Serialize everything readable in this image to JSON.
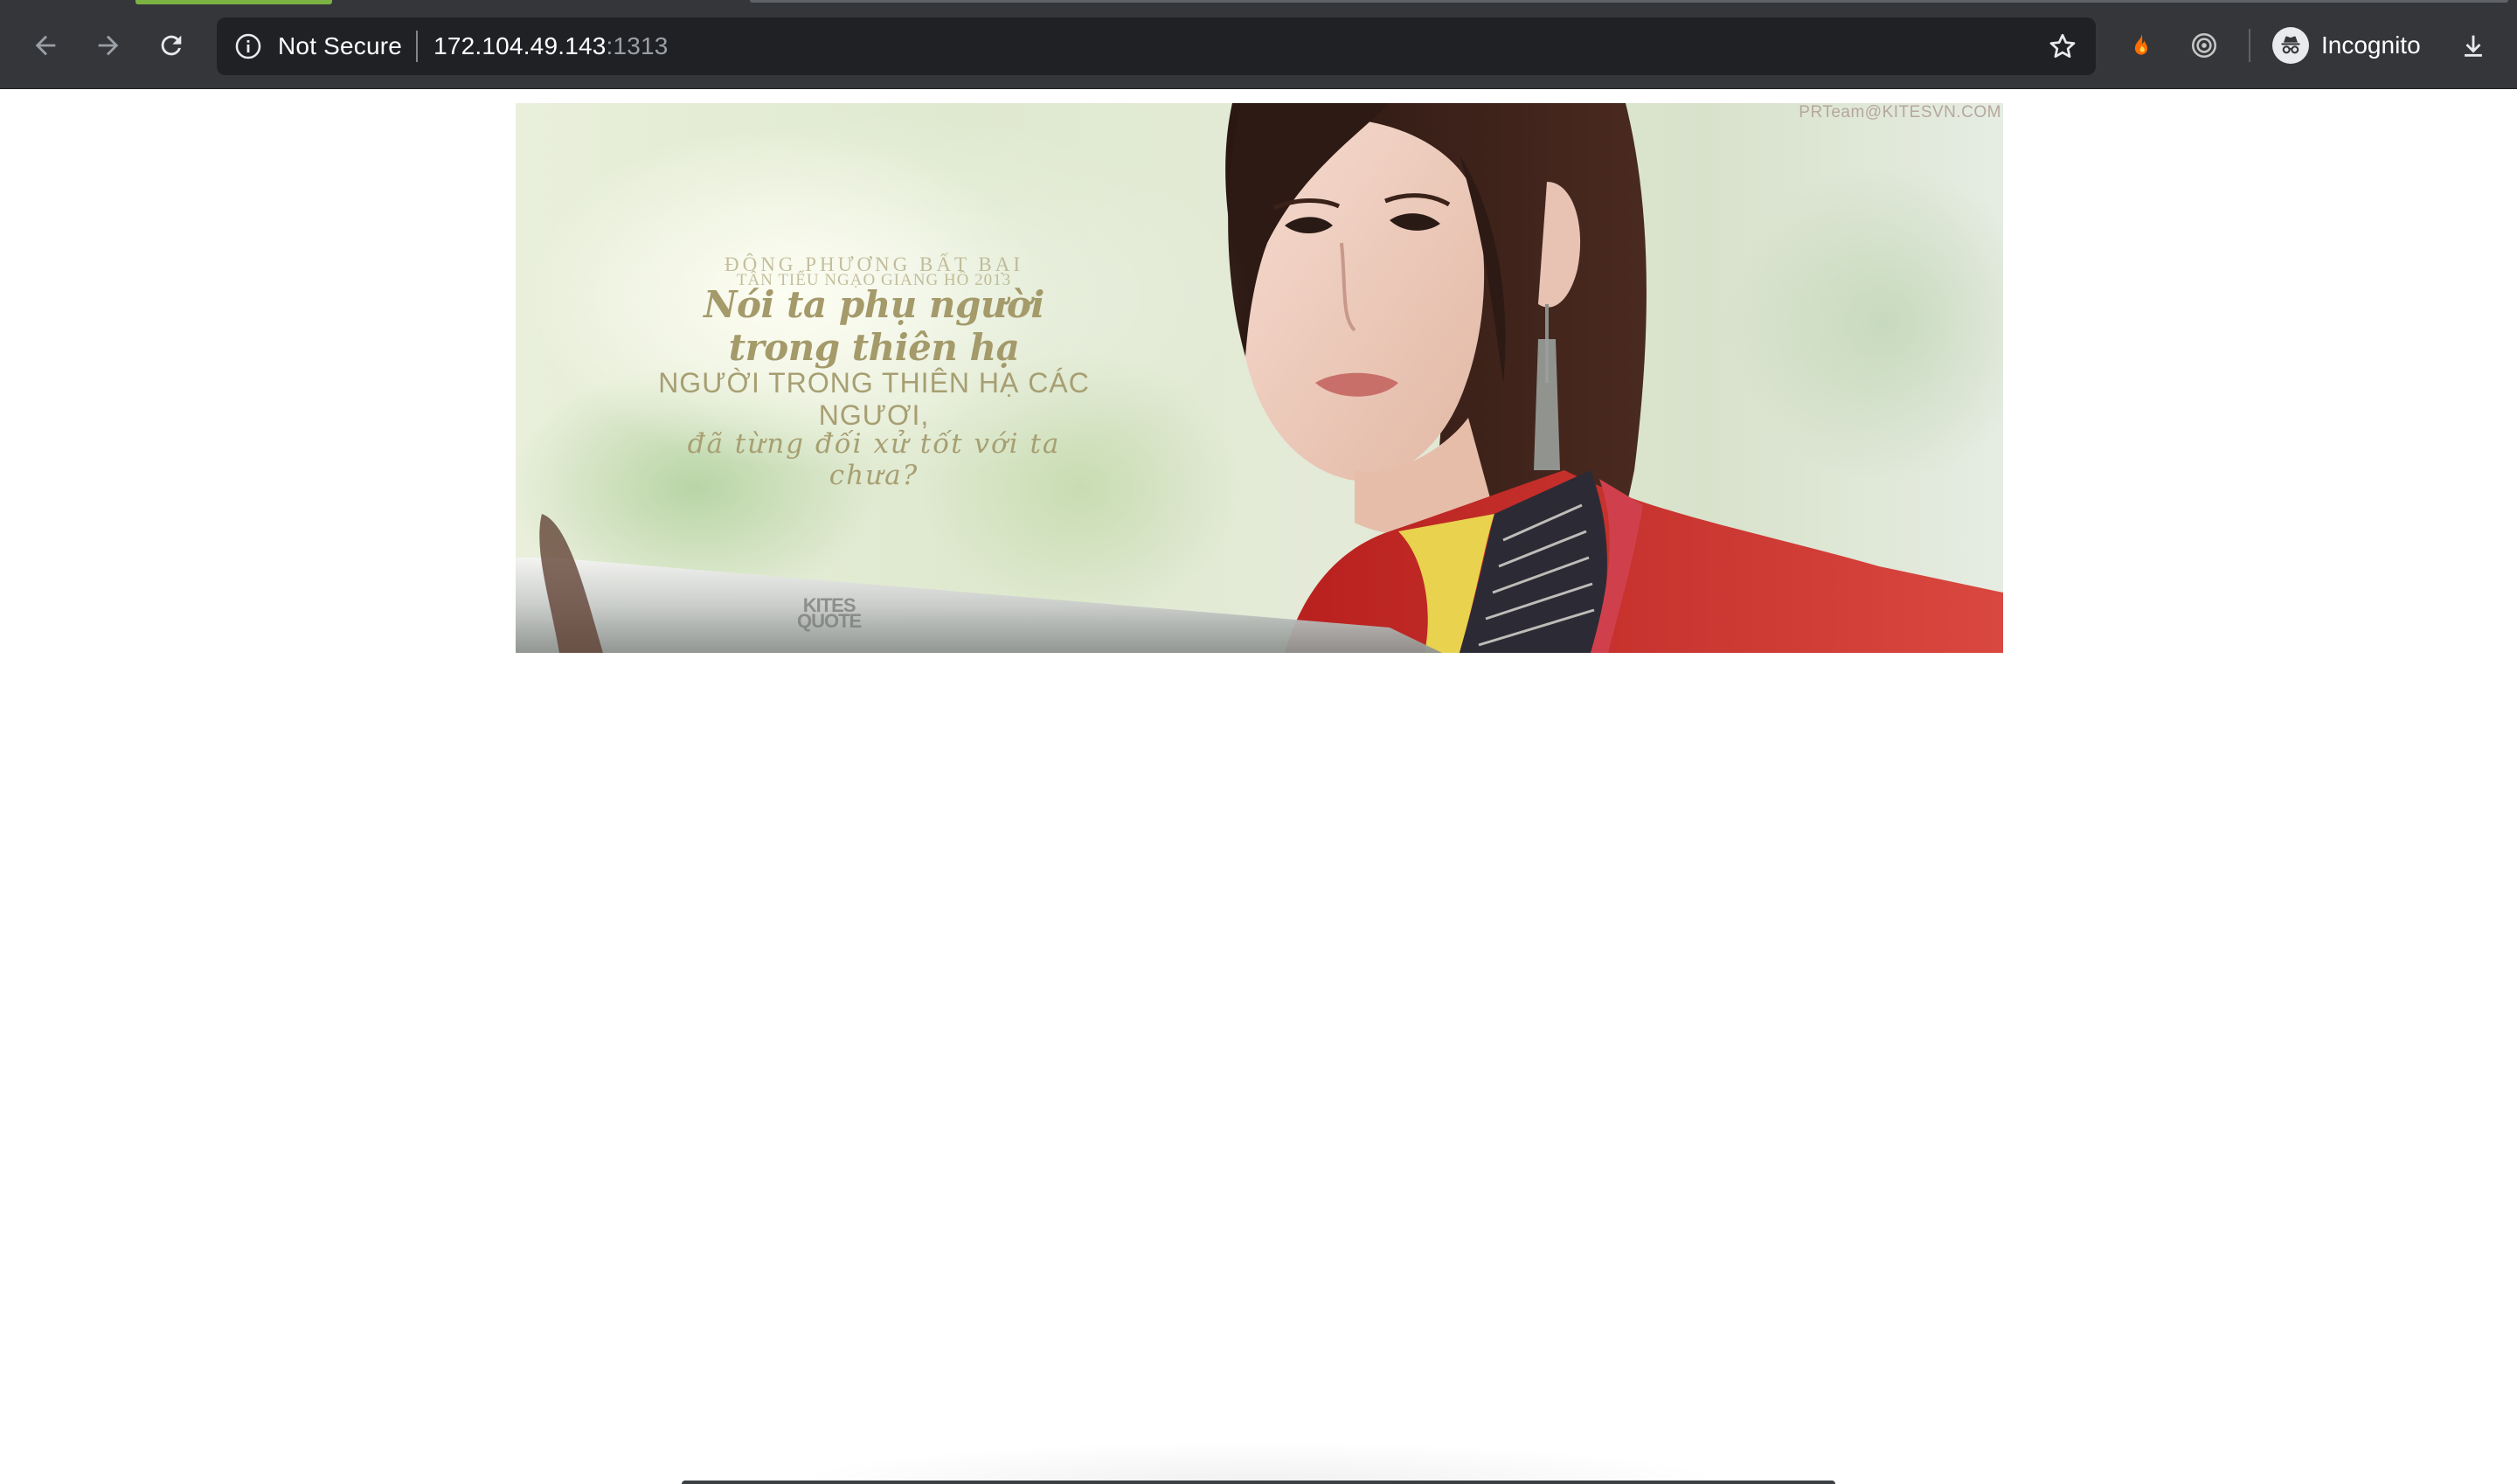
{
  "browser": {
    "security_label": "Not Secure",
    "url_host": "172.104.49.143",
    "url_port": ":1313",
    "profile_label": "Incognito",
    "icons": {
      "back": "arrow-left-icon",
      "forward": "arrow-right-icon",
      "reload": "reload-icon",
      "info": "info-icon",
      "bookmark": "star-icon",
      "extension_1": "fire-icon",
      "extension_2": "target-icon",
      "profile": "incognito-icon",
      "download": "download-icon"
    },
    "colors": {
      "toolbar": "#35363a",
      "omnibox": "#202124",
      "load_progress": "#7cb342"
    }
  },
  "banner": {
    "line1": "ĐÔNG PHƯƠNG BẤT BẠI",
    "line2": "TÂN TIẾU NGẠO GIANG HỒ 2013",
    "line3": "Nói ta phụ người trong thiên hạ",
    "line4": "NGƯỜI TRONG THIÊN HẠ CÁC NGƯƠI,",
    "line5": "đã từng đối xử tốt với ta chưa?",
    "watermark": "PRTeam@KITESVN.COM",
    "logo_top": "KITES",
    "logo_bottom": "QUOTE"
  }
}
